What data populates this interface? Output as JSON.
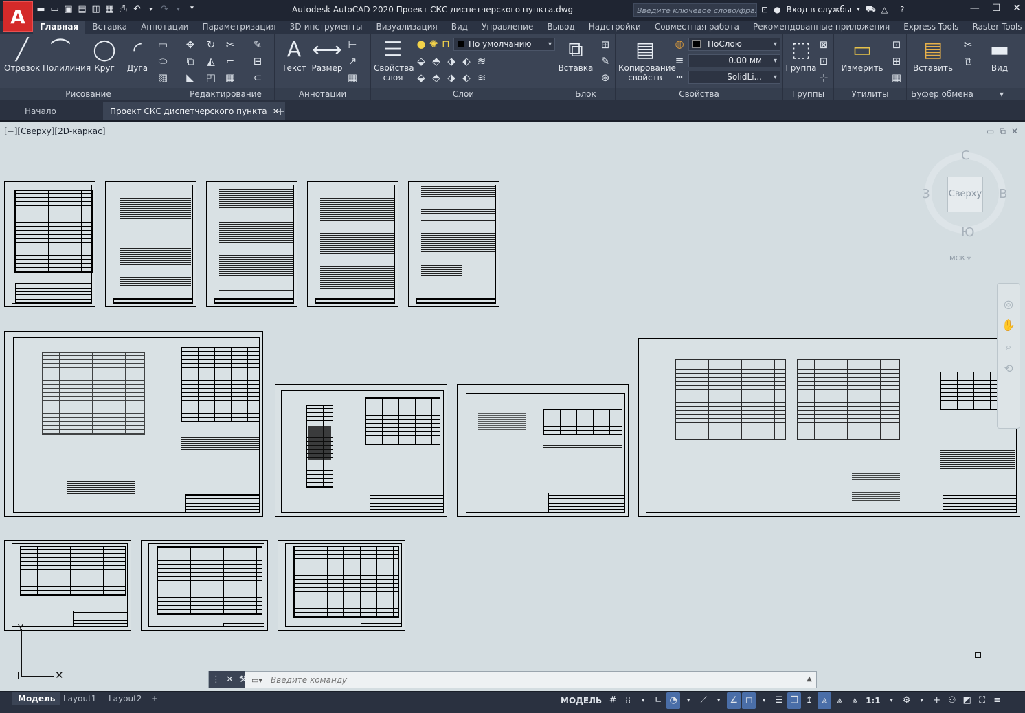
{
  "window": {
    "app_logo": "A",
    "title": "Autodesk AutoCAD 2020    Проект СКС диспетчерского пункта.dwg",
    "search_placeholder": "Введите ключевое слово/фразу",
    "sign_in": "Вход в службы"
  },
  "ribbon_tabs": [
    "Главная",
    "Вставка",
    "Аннотации",
    "Параметризация",
    "3D-инструменты",
    "Визуализация",
    "Вид",
    "Управление",
    "Вывод",
    "Надстройки",
    "Совместная работа",
    "Рекомендованные приложения",
    "Express Tools",
    "Raster Tools"
  ],
  "panels": {
    "draw": {
      "title": "Рисование",
      "line": "Отрезок",
      "polyline": "Полилиния",
      "circle": "Круг",
      "arc": "Дуга"
    },
    "modify": {
      "title": "Редактирование"
    },
    "annotation": {
      "title": "Аннотации",
      "text": "Текст",
      "dimension": "Размер"
    },
    "layers": {
      "title": "Слои",
      "layer_props_1": "Свойства",
      "layer_props_2": "слоя",
      "layer_current": "По умолчанию"
    },
    "block": {
      "title": "Блок",
      "insert": "Вставка"
    },
    "properties": {
      "title": "Свойства",
      "match_1": "Копирование",
      "match_2": "свойств",
      "color": "ПоСлою",
      "lineweight": "0.00 мм",
      "linetype": "SolidLi..."
    },
    "groups": {
      "title": "Группы",
      "group": "Группа"
    },
    "utilities": {
      "title": "Утилиты",
      "measure": "Измерить"
    },
    "clipboard": {
      "title": "Буфер обмена",
      "paste": "Вставить"
    },
    "view": {
      "title": "Вид"
    }
  },
  "doc_tabs": {
    "start": "Начало",
    "file": "Проект СКС диспетчерского пункта"
  },
  "viewport": {
    "label": "[−][Сверху][2D-каркас]",
    "viewcube": {
      "face": "Сверху",
      "n": "С",
      "s": "Ю",
      "w": "З",
      "e": "В",
      "wcs": "МСК"
    }
  },
  "command": {
    "placeholder": "Введите команду"
  },
  "layout_tabs": [
    "Модель",
    "Layout1",
    "Layout2"
  ],
  "status": {
    "model": "МОДЕЛЬ",
    "scale": "1:1"
  },
  "colors": {
    "accent": "#4a6ea8",
    "ribbon_bg": "#3b4455",
    "viewport_bg": "#d4dde1",
    "logo": "#d42a2a"
  }
}
